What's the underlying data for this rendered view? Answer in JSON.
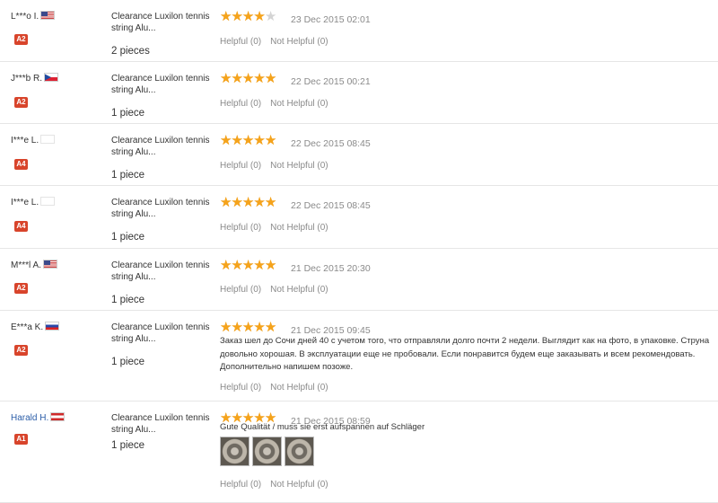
{
  "colors": {
    "star_on": "#f5a31b",
    "star_off": "#d4d4d4",
    "badge_bg": "#d8442b",
    "link": "#2c5ea8",
    "muted": "#8a8a8a"
  },
  "reviews": [
    {
      "user": "L***o I.",
      "flag": "us",
      "level": "A2",
      "product": "Clearance Luxilon tennis string Alu...",
      "quantity": "2 pieces",
      "stars": 4,
      "date": "23 Dec 2015 02:01",
      "helpful": "Helpful (0)",
      "not_helpful": "Not Helpful (0)"
    },
    {
      "user": "J***b R.",
      "flag": "cz",
      "level": "A2",
      "product": "Clearance Luxilon tennis string Alu...",
      "quantity": "1 piece",
      "stars": 5,
      "date": "22 Dec 2015 00:21",
      "helpful": "Helpful (0)",
      "not_helpful": "Not Helpful (0)"
    },
    {
      "user": "I***e L.",
      "flag": "blank",
      "level": "A4",
      "product": "Clearance Luxilon tennis string Alu...",
      "quantity": "1 piece",
      "stars": 5,
      "date": "22 Dec 2015 08:45",
      "helpful": "Helpful (0)",
      "not_helpful": "Not Helpful (0)"
    },
    {
      "user": "I***e L.",
      "flag": "blank",
      "level": "A4",
      "product": "Clearance Luxilon tennis string Alu...",
      "quantity": "1 piece",
      "stars": 5,
      "date": "22 Dec 2015 08:45",
      "helpful": "Helpful (0)",
      "not_helpful": "Not Helpful (0)"
    },
    {
      "user": "M***l A.",
      "flag": "us",
      "level": "A2",
      "product": "Clearance Luxilon tennis string Alu...",
      "quantity": "1 piece",
      "stars": 5,
      "date": "21 Dec 2015 20:30",
      "helpful": "Helpful (0)",
      "not_helpful": "Not Helpful (0)"
    },
    {
      "user": "E***a K.",
      "flag": "ru",
      "level": "A2",
      "product": "Clearance Luxilon tennis string Alu...",
      "quantity": "1 piece",
      "stars": 5,
      "date": "21 Dec 2015 09:45",
      "comment": "Заказ шел до Сочи дней 40 с учетом того, что отправляли долго почти 2 недели. Выглядит как на фото, в упаковке. Струна довольно хорошая. В эксплуатации еще не пробовали. Если понравится будем еще заказывать и всем рекомендовать. Дополнительно напишем позоже.",
      "helpful": "Helpful (0)",
      "not_helpful": "Not Helpful (0)"
    },
    {
      "user": "Harald H.",
      "flag": "at",
      "level": "A1",
      "product": "Clearance Luxilon tennis string Alu...",
      "quantity": "1 piece",
      "stars": 5,
      "date": "21 Dec 2015 08:59",
      "comment": "Gute Qualität / muss sie erst aufspannen auf Schläger",
      "photos": 3,
      "helpful": "Helpful (0)",
      "not_helpful": "Not Helpful (0)"
    }
  ]
}
